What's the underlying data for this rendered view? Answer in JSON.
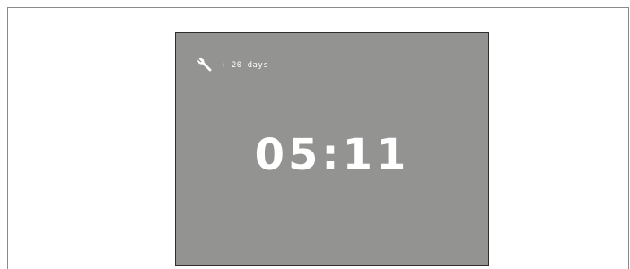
{
  "maintenance": {
    "icon": "wrench-icon",
    "text": ": 20 days"
  },
  "clock": {
    "time": "05:11"
  },
  "colors": {
    "screen_bg": "#939492",
    "foreground": "#ffffff"
  }
}
